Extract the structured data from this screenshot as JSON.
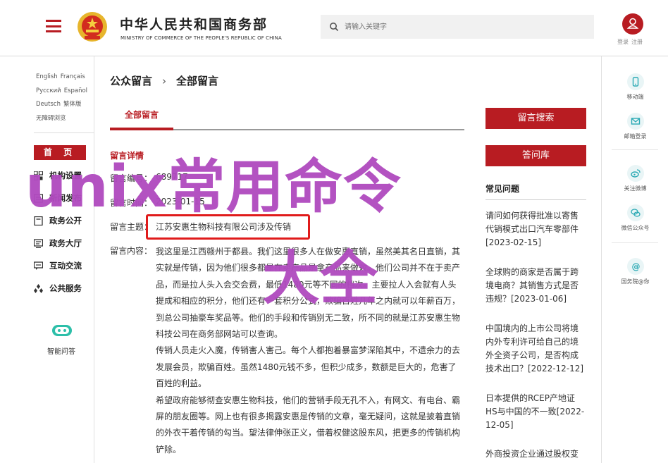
{
  "header": {
    "brand_cn": "中华人民共和国商务部",
    "brand_en": "MINISTRY OF COMMERCE OF THE PEOPLE'S REPUBLIC OF CHINA",
    "search_placeholder": "请输入关键字",
    "login": "登录",
    "register": "注册",
    "accent": "#b81c22"
  },
  "leftnav": {
    "langs": [
      "English",
      "Français",
      "Русский",
      "Español",
      "Deutsch",
      "繁体版",
      "无障碍浏览"
    ],
    "home": "首 页",
    "items": [
      {
        "label": "机构设置",
        "icon": "org-grid-icon"
      },
      {
        "label": "新闻发布",
        "icon": "news-icon"
      },
      {
        "label": "政务公开",
        "icon": "public-icon"
      },
      {
        "label": "政务大厅",
        "icon": "hall-icon"
      },
      {
        "label": "互动交流",
        "icon": "chat-icon"
      },
      {
        "label": "公共服务",
        "icon": "service-icon"
      }
    ],
    "robot_label": "智能问答"
  },
  "rightbar": {
    "items": [
      {
        "label": "移动端",
        "icon": "mobile-icon"
      },
      {
        "label": "邮箱登录",
        "icon": "mail-icon"
      },
      {
        "label": "关注微博",
        "icon": "weibo-icon"
      },
      {
        "label": "微信公众号",
        "icon": "wechat-icon"
      },
      {
        "label": "国务院@你",
        "icon": "at-icon"
      }
    ]
  },
  "main": {
    "breadcrumb": [
      "公众留言",
      "全部留言"
    ],
    "tab": "全部留言",
    "section_title": "留言详情",
    "meta": [
      {
        "label": "留言编号：",
        "value": "689717"
      },
      {
        "label": "留言时间：",
        "value": "2023-01-15"
      },
      {
        "label": "留言主题：",
        "value": "江苏安惠生物科技有限公司涉及传销"
      }
    ],
    "content_label": "留言内容：",
    "paragraphs": [
      "我这里是江西赣州于都县。我们这里很多人在做安惠直销，虽然美其名日直销，其实就是传销，因为他们很多都是在卖产品是拿产品来做效。他们公司并不在于卖产品，而是拉人头入会交会费，最低1480元等不同的档次。主要拉人入会就有人头提成和相应的积分，他们还有一套积分公式，欺骗百姓几年之内就可以年薪百万，到总公司抽豪车奖品等。他们的手段和传销别无二致，所不同的就是江苏安惠生物科技公司在商务部网站可以查询。",
      "传销人员走火入魔，传销害人害己。每个人都抱着暴富梦深陷其中，不遗余力的去发展会员，欺骗百姓。虽然1480元钱不多，但积少成多，数额是巨大的，危害了百姓的利益。",
      "希望政府能够彻查安惠生物科技，他们的营销手段无孔不入，有网文、有电台、霸屏的朋友圈等。网上也有很多揭露安惠是传销的文章，毫无疑问，这就是披着直销的外衣干着传销的勾当。望法律伸张正义，借着权健这股东风，把更多的传销机构铲除。"
    ]
  },
  "side": {
    "search_btn": "留言搜索",
    "faq_btn": "答问库",
    "faq_title": "常见问题",
    "faq_items": [
      "请问如何获得批准以寄售代销模式出口汽车零部件[2023-02-15]",
      "全球购的商家是否属于跨境电商？其销售方式是否违规？[2023-01-06]",
      "中国境内的上市公司将境内外专利许可给自己的境外全资子公司，是否构成技术出口？[2022-12-12]",
      "日本提供的RCEP产地证HS与中国的不一致[2022-12-05]",
      "外商投资企业通过股权变"
    ]
  },
  "watermark": {
    "line1": "unix常用命令",
    "line2": "大全",
    "color": "#b04bbf"
  }
}
